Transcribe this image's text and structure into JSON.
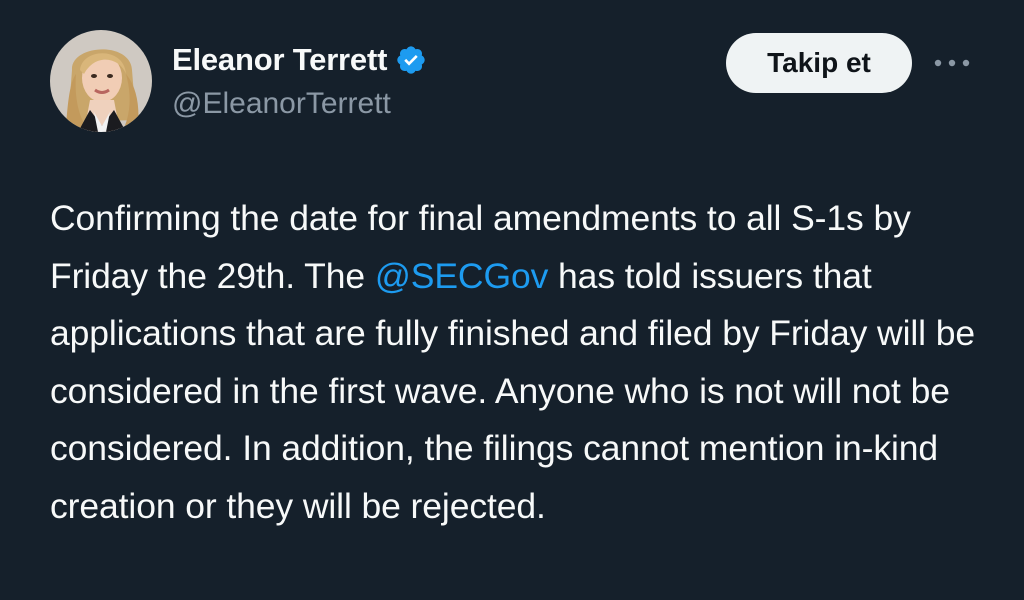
{
  "author": {
    "display_name": "Eleanor Terrett",
    "handle": "@EleanorTerrett",
    "verified": true,
    "avatar_icon": "profile-photo"
  },
  "actions": {
    "follow_label": "Takip et",
    "more_icon": "more-horizontal-icon"
  },
  "tweet": {
    "text_part1": "Confirming the date for final amendments to all S-1s by Friday the 29th. The ",
    "mention": "@SECGov",
    "text_part2": " has told issuers that applications that are fully finished and filed by Friday will be considered in the first wave. Anyone who is not will not be considered. In addition, the filings cannot mention in-kind creation or they will be rejected."
  },
  "colors": {
    "background": "#15202b",
    "text": "#f7f9f9",
    "secondary_text": "#8b98a5",
    "accent": "#1d9bf0",
    "follow_bg": "#eff3f4"
  }
}
